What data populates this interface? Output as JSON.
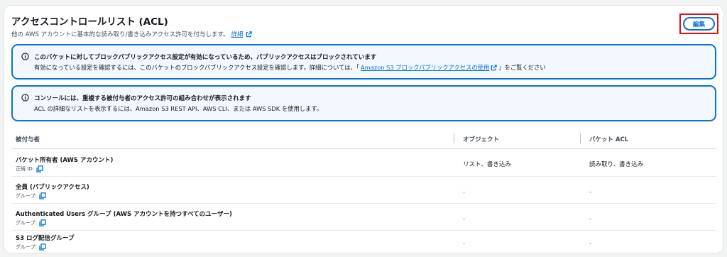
{
  "header": {
    "title": "アクセスコントロールリスト (ACL)",
    "description": "他の AWS アカウントに基本的な読み取り/書き込みアクセス許可を付与します。",
    "details_link": "詳細",
    "edit_label": "編集"
  },
  "alerts": [
    {
      "title": "このバケットに対してブロックパブリックアクセス設定が有効になっているため、パブリックアクセスはブロックされています",
      "text_before": "有効になっている設定を確認するには、このバケットのブロックパブリックアクセス設定を確認します。詳細については、「",
      "link": "Amazon S3 ブロックパブリックアクセスの使用",
      "text_after": "」をご覧ください"
    },
    {
      "title": "コンソールには、重複する被付与者のアクセス許可の組み合わせが表示されます",
      "text_before": "ACL の詳細なリストを表示するには、Amazon S3 REST API、AWS CLI、または AWS SDK を使用します。"
    }
  ],
  "table": {
    "columns": [
      "被付与者",
      "オブジェクト",
      "バケット ACL"
    ],
    "rows": [
      {
        "name": "バケット所有者 (AWS アカウント)",
        "sub": "正規 ID:",
        "object": "リスト、書き込み",
        "bucket_acl": "読み取り、書き込み"
      },
      {
        "name": "全員 (パブリックアクセス)",
        "sub": "グループ:",
        "object": "-",
        "bucket_acl": "-"
      },
      {
        "name": "Authenticated Users グループ (AWS アカウントを持つすべてのユーザー)",
        "sub": "グループ:",
        "object": "-",
        "bucket_acl": "-"
      },
      {
        "name": "S3 ログ配信グループ",
        "sub": "グループ:",
        "object": "-",
        "bucket_acl": "-"
      }
    ]
  },
  "colors": {
    "accent": "#0972d3",
    "highlight_border": "#d91515",
    "alert_bg": "#f2f8fd"
  },
  "icons": {
    "info": "info-icon",
    "external": "external-link-icon",
    "copy": "copy-icon"
  }
}
